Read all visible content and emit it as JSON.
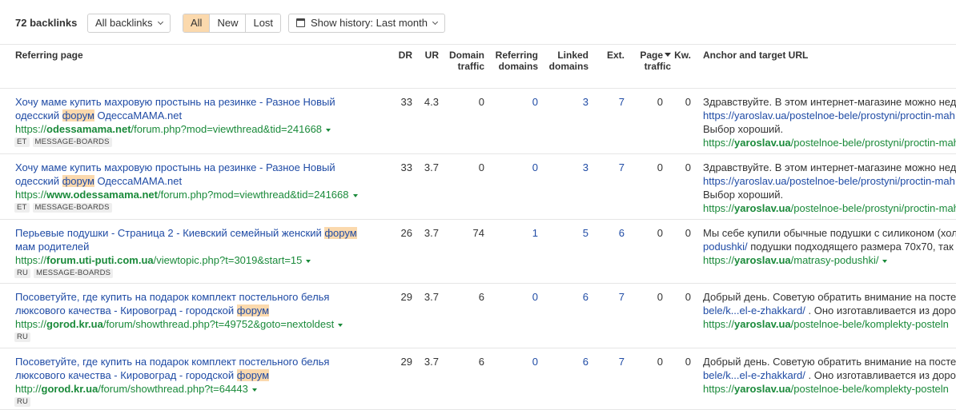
{
  "toolbar": {
    "count_label": "72 backlinks",
    "filter_label": "All backlinks",
    "segments": [
      "All",
      "New",
      "Lost"
    ],
    "history_label": "Show history: Last month"
  },
  "columns": {
    "referring_page": "Referring page",
    "dr": "DR",
    "ur": "UR",
    "domain_traffic_1": "Domain",
    "domain_traffic_2": "traffic",
    "referring_domains_1": "Referring",
    "referring_domains_2": "domains",
    "linked_domains_1": "Linked",
    "linked_domains_2": "domains",
    "ext": "Ext.",
    "page_traffic_1": "Page",
    "page_traffic_2": "traffic",
    "kw": "Kw.",
    "anchor": "Anchor and target URL"
  },
  "rows": [
    {
      "title_a": "Хочу маме купить махровую простынь на резинке - Разное Новый одесский ",
      "title_hl": "форум",
      "title_b": " ОдессаМАМА.net",
      "url_prefix": "https://",
      "url_domain": "odessamama.net",
      "url_path": "/forum.php?mod=viewthread&tid=241668",
      "tags": [
        "ET",
        "MESSAGE-BOARDS"
      ],
      "dr": "33",
      "ur": "4.3",
      "domain_traffic": "0",
      "referring_domains": "0",
      "linked_domains": "3",
      "ext": "7",
      "page_traffic": "0",
      "kw": "0",
      "anchor_l1": "Здравствуйте. В этом интернет-магазине можно недо",
      "anchor_l2": "https://yaroslav.ua/postelnoe-bele/prostyni/proctin-mah",
      "anchor_l2_rest": "",
      "anchor_l3": "Выбор хороший.",
      "target_prefix": "https://",
      "target_domain": "yaroslav.ua",
      "target_path": "/postelnoe-bele/prostyni/proctin-mah"
    },
    {
      "title_a": "Хочу маме купить махровую простынь на резинке - Разное Новый одесский ",
      "title_hl": "форум",
      "title_b": " ОдессаМАМА.net",
      "url_prefix": "https://",
      "url_domain": "www.odessamama.net",
      "url_path": "/forum.php?mod=viewthread&tid=241668",
      "tags": [
        "ET",
        "MESSAGE-BOARDS"
      ],
      "dr": "33",
      "ur": "3.7",
      "domain_traffic": "0",
      "referring_domains": "0",
      "linked_domains": "3",
      "ext": "7",
      "page_traffic": "0",
      "kw": "0",
      "anchor_l1": "Здравствуйте. В этом интернет-магазине можно недо",
      "anchor_l2": "https://yaroslav.ua/postelnoe-bele/prostyni/proctin-mah",
      "anchor_l2_rest": "",
      "anchor_l3": "Выбор хороший.",
      "target_prefix": "https://",
      "target_domain": "yaroslav.ua",
      "target_path": "/postelnoe-bele/prostyni/proctin-mah"
    },
    {
      "title_a": "Перьевые подушки - Страница 2 - Киевский семейный женский ",
      "title_hl": "форум",
      "title_b": " мам родителей",
      "url_prefix": "https://",
      "url_domain": "forum.uti-puti.com.ua",
      "url_path": "/viewtopic.php?t=3019&start=15",
      "tags": [
        "RU",
        "MESSAGE-BOARDS"
      ],
      "dr": "26",
      "ur": "3.7",
      "domain_traffic": "74",
      "referring_domains": "1",
      "linked_domains": "5",
      "ext": "6",
      "page_traffic": "0",
      "kw": "0",
      "anchor_l1": "Мы себе купили обычные подушки с силиконом (хол",
      "anchor_l2": "podushki/",
      "anchor_l2_rest": " подушки подходящего размера 70х70, так",
      "anchor_l3": "",
      "target_prefix": "https://",
      "target_domain": "yaroslav.ua",
      "target_path": "/matrasy-podushki/"
    },
    {
      "title_a": "Посоветуйте, где купить на подарок комплект постельного белья люксового качества - Кировоград - городской ",
      "title_hl": "форум",
      "title_b": "",
      "url_prefix": "https://",
      "url_domain": "gorod.kr.ua",
      "url_path": "/forum/showthread.php?t=49752&goto=nextoldest",
      "tags": [
        "RU"
      ],
      "dr": "29",
      "ur": "3.7",
      "domain_traffic": "6",
      "referring_domains": "0",
      "linked_domains": "6",
      "ext": "7",
      "page_traffic": "0",
      "kw": "0",
      "anchor_l1": "Добрый день. Советую обратить внимание на посте",
      "anchor_l2": "bele/k...el-e-zhakkard/",
      "anchor_l2_rest": " . Оно изготавливается из дорог",
      "anchor_l3": "",
      "target_prefix": "https://",
      "target_domain": "yaroslav.ua",
      "target_path": "/postelnoe-bele/komplekty-posteln"
    },
    {
      "title_a": "Посоветуйте, где купить на подарок комплект постельного белья люксового качества - Кировоград - городской ",
      "title_hl": "форум",
      "title_b": "",
      "url_prefix": "http://",
      "url_domain": "gorod.kr.ua",
      "url_path": "/forum/showthread.php?t=64443",
      "tags": [
        "RU"
      ],
      "dr": "29",
      "ur": "3.7",
      "domain_traffic": "6",
      "referring_domains": "0",
      "linked_domains": "6",
      "ext": "7",
      "page_traffic": "0",
      "kw": "0",
      "anchor_l1": "Добрый день. Советую обратить внимание на посте",
      "anchor_l2": "bele/k...el-e-zhakkard/",
      "anchor_l2_rest": " . Оно изготавливается из дорог",
      "anchor_l3": "",
      "target_prefix": "https://",
      "target_domain": "yaroslav.ua",
      "target_path": "/postelnoe-bele/komplekty-posteln"
    }
  ]
}
